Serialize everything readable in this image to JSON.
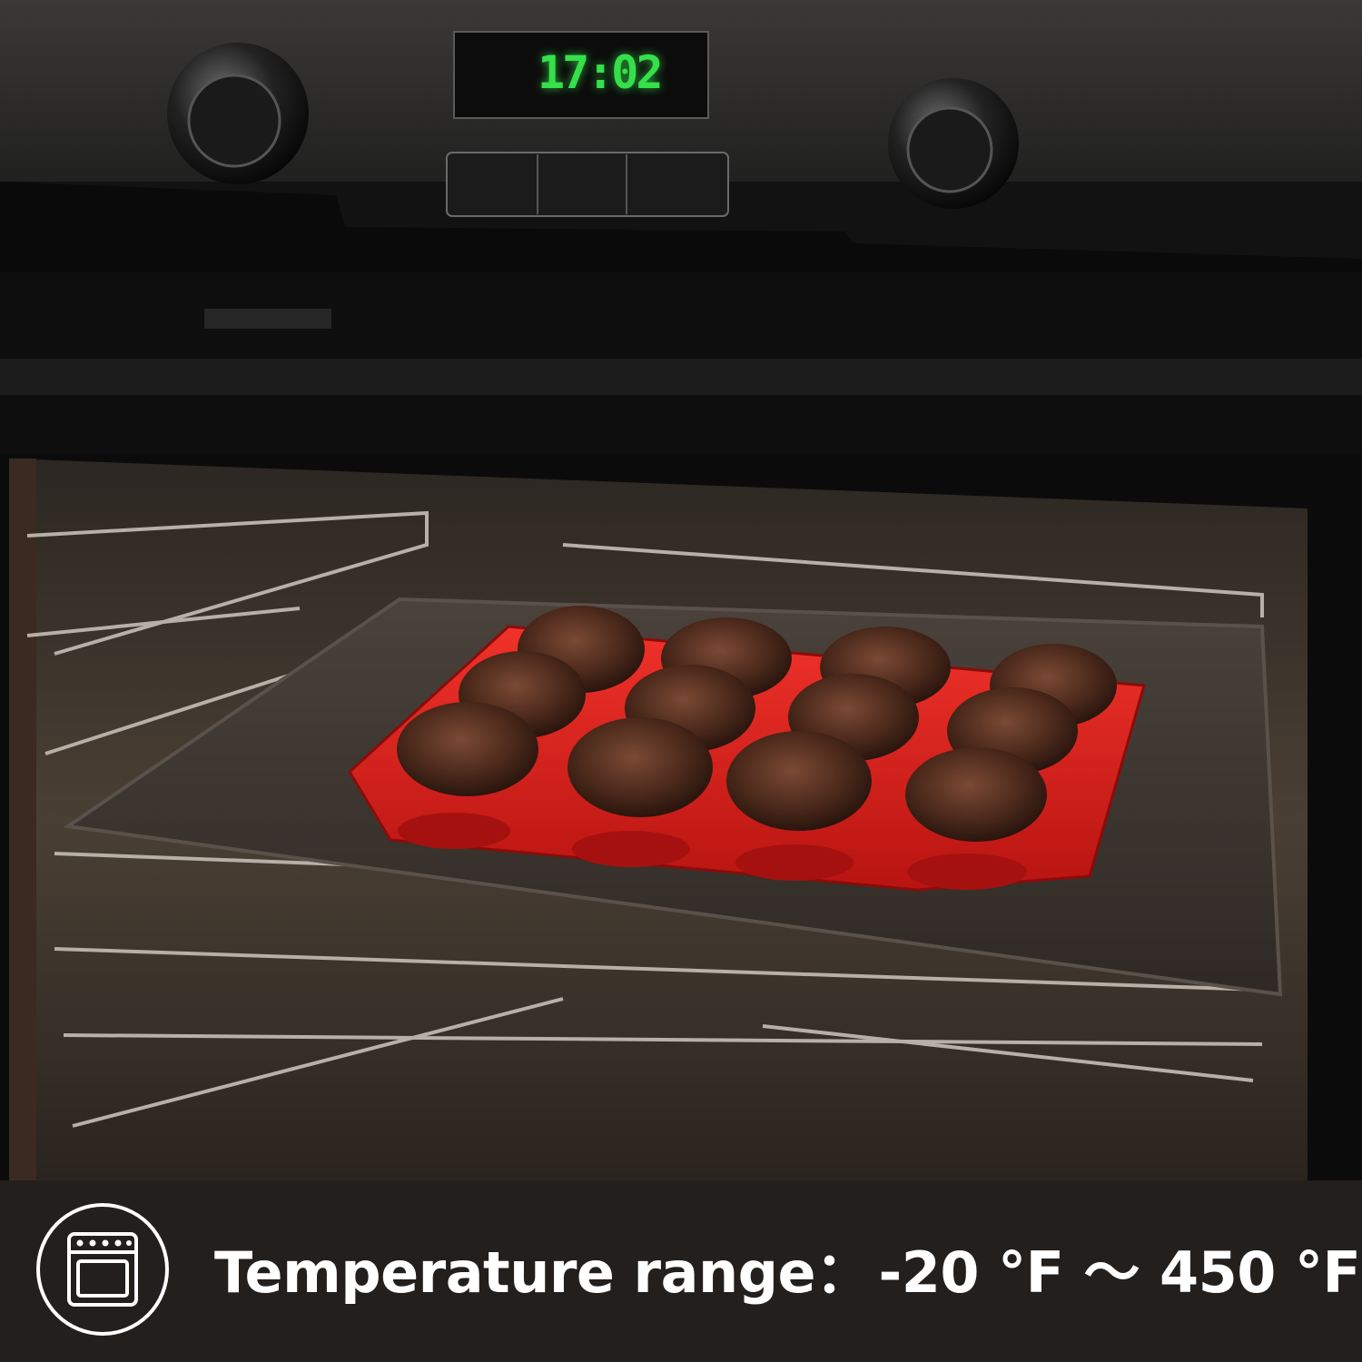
{
  "oven_display": {
    "time": "17:02"
  },
  "banner": {
    "label": "Temperature range",
    "separator": "：",
    "min": "-20 °F",
    "range_mark": "～",
    "max": "450 °F",
    "icon": "oven-icon"
  },
  "colors": {
    "silicone_pan": "#d81c18",
    "baking_tray": "#3a342f",
    "display_digits": "#35e04a",
    "banner_text": "#ffffff"
  }
}
